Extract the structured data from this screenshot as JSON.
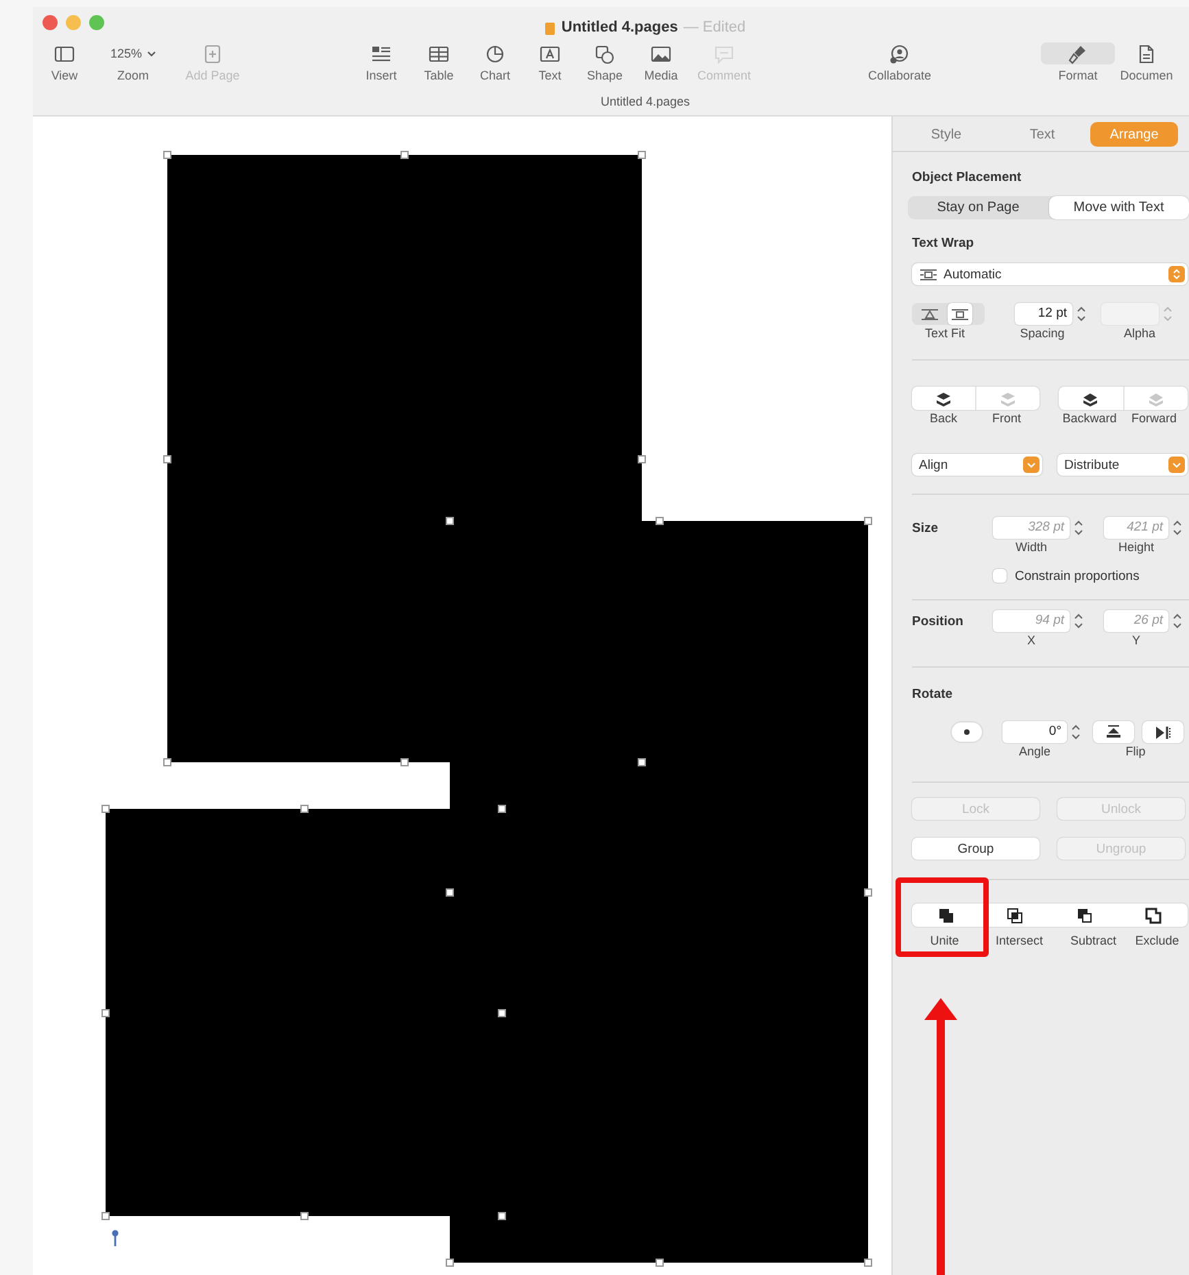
{
  "window": {
    "title": "Untitled 4.pages",
    "status": "— Edited",
    "subtitle": "Untitled 4.pages"
  },
  "toolbar": {
    "groups": [
      [
        {
          "label": "View",
          "kind": "button",
          "disabled": false
        },
        {
          "label": "Zoom",
          "kind": "zoom",
          "value": "125%",
          "disabled": false
        },
        {
          "label": "Add Page",
          "kind": "button",
          "disabled": true
        }
      ],
      [
        {
          "label": "Insert",
          "kind": "button",
          "disabled": false
        },
        {
          "label": "Table",
          "kind": "button",
          "disabled": false
        },
        {
          "label": "Chart",
          "kind": "button",
          "disabled": false
        },
        {
          "label": "Text",
          "kind": "button",
          "disabled": false
        },
        {
          "label": "Shape",
          "kind": "button",
          "disabled": false
        },
        {
          "label": "Media",
          "kind": "button",
          "disabled": false
        },
        {
          "label": "Comment",
          "kind": "button",
          "disabled": true
        }
      ],
      [
        {
          "label": "Collaborate",
          "kind": "button",
          "disabled": false
        }
      ],
      [
        {
          "label": "Format",
          "kind": "toggle",
          "disabled": false,
          "selected": true
        },
        {
          "label": "Documen",
          "kind": "toggle",
          "disabled": false,
          "selected": false
        }
      ]
    ]
  },
  "canvas": {
    "shapes": [
      {
        "kind": "rectangle",
        "selected": true
      },
      {
        "kind": "rectangle",
        "selected": true
      },
      {
        "kind": "rectangle",
        "selected": true
      }
    ]
  },
  "inspector": {
    "tabs": [
      {
        "label": "Style",
        "selected": false
      },
      {
        "label": "Text",
        "selected": false
      },
      {
        "label": "Arrange",
        "selected": true
      }
    ],
    "object_placement": {
      "title": "Object Placement",
      "options": [
        {
          "label": "Stay on Page",
          "selected": false
        },
        {
          "label": "Move with Text",
          "selected": true
        }
      ]
    },
    "text_wrap": {
      "title": "Text Wrap",
      "value": "Automatic",
      "text_fit": {
        "label": "Text Fit",
        "options": [
          {
            "selected": false
          },
          {
            "selected": true
          }
        ]
      },
      "spacing": {
        "value": "12 pt",
        "label": "Spacing",
        "disabled": false
      },
      "alpha": {
        "label": "Alpha",
        "disabled": true
      }
    },
    "arrange": [
      {
        "label": "Back",
        "disabled": false
      },
      {
        "label": "Front",
        "disabled": true
      },
      {
        "label": "Backward",
        "disabled": false
      },
      {
        "label": "Forward",
        "disabled": true
      }
    ],
    "align": {
      "label": "Align"
    },
    "distribute": {
      "label": "Distribute"
    },
    "size": {
      "title": "Size",
      "width": {
        "value": "328 pt",
        "label": "Width",
        "disabled": true
      },
      "height": {
        "value": "421 pt",
        "label": "Height",
        "disabled": true
      }
    },
    "constrain": {
      "label": "Constrain proportions",
      "checked": false
    },
    "position": {
      "title": "Position",
      "x": {
        "value": "94 pt",
        "label": "X",
        "disabled": true
      },
      "y": {
        "value": "26 pt",
        "label": "Y",
        "disabled": true
      }
    },
    "rotate": {
      "title": "Rotate",
      "angle": {
        "value": "0°",
        "label": "Angle",
        "disabled": false
      },
      "flip": {
        "label": "Flip"
      }
    },
    "lock": [
      {
        "label": "Lock",
        "disabled": true
      },
      {
        "label": "Unlock",
        "disabled": true
      }
    ],
    "group": [
      {
        "label": "Group",
        "disabled": false
      },
      {
        "label": "Ungroup",
        "disabled": true
      }
    ],
    "shape_ops": [
      {
        "label": "Unite"
      },
      {
        "label": "Intersect"
      },
      {
        "label": "Subtract"
      },
      {
        "label": "Exclude"
      }
    ]
  }
}
